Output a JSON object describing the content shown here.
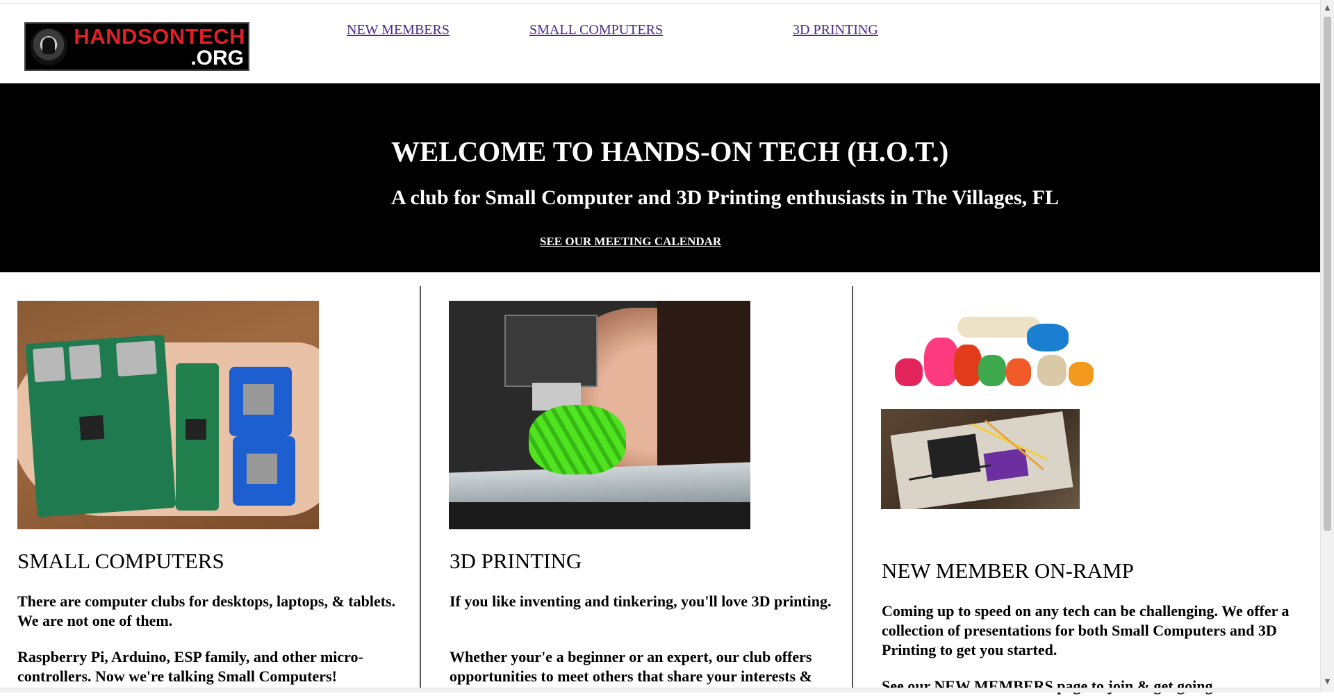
{
  "logo": {
    "line1": "HANDSONTECH",
    "line2": ".ORG"
  },
  "nav": {
    "new_members": "NEW MEMBERS",
    "small_computers": "SMALL COMPUTERS",
    "printing": "3D PRINTING"
  },
  "hero": {
    "title": "WELCOME TO HANDS-ON TECH (H.O.T.)",
    "subtitle": "A club for Small Computer and 3D Printing enthusiasts in The Villages, FL",
    "calendar_link": "SEE OUR MEETING CALENDAR"
  },
  "columns": {
    "small_computers": {
      "heading": "SMALL COMPUTERS",
      "p1": "There are computer clubs for desktops, laptops, & tablets. We are not one of them.",
      "p2": "Raspberry Pi, Arduino, ESP family, and other micro-controllers. Now we're talking Small Computers!"
    },
    "printing": {
      "heading": "3D PRINTING",
      "p1": "If you like inventing and tinkering, you'll love 3D printing.",
      "p2": "Whether your'e a beginner or an expert, our club offers opportunities to meet others that share your interests &"
    },
    "new_member": {
      "heading": "NEW MEMBER ON-RAMP",
      "p1": "Coming up to speed on any tech can be challenging. We offer a collection of presentations for both Small Computers and 3D Printing to get you started.",
      "p2_prefix": "See our ",
      "p2_link": "NEW MEMBERS",
      "p2_suffix": " page to join & get going."
    }
  },
  "colors": {
    "link": "#4b2a8a",
    "hero_bg": "#000000",
    "logo_red": "#e21f26"
  },
  "icons": {
    "scroll_up": "▲",
    "scroll_down": "▼"
  }
}
